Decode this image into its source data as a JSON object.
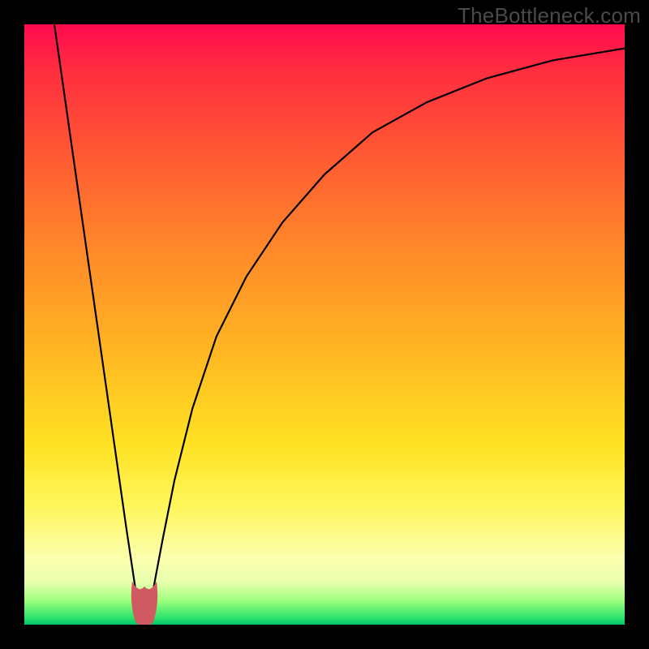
{
  "watermark": {
    "text": "TheBottleneck.com"
  },
  "chart_data": {
    "type": "line",
    "title": "",
    "xlabel": "",
    "ylabel": "",
    "xlim": [
      0,
      100
    ],
    "ylim": [
      0,
      100
    ],
    "grid": false,
    "series": [
      {
        "name": "bottleneck-curve",
        "x": [
          5,
          7,
          9,
          11,
          13,
          15,
          17,
          18.5,
          20,
          21.5,
          23,
          25,
          28,
          32,
          37,
          43,
          50,
          58,
          67,
          77,
          88,
          100
        ],
        "y": [
          100,
          86,
          72,
          58,
          44,
          30,
          16,
          6,
          0,
          6,
          14,
          24,
          36,
          48,
          58,
          67,
          75,
          82,
          87,
          91,
          94,
          96
        ]
      }
    ],
    "highlight": {
      "name": "sweet-spot-blob",
      "x_range": [
        18,
        22
      ],
      "y_range": [
        0,
        7
      ],
      "color": "#cf5a62"
    },
    "background_gradient": {
      "direction": "vertical",
      "stops": [
        {
          "pos": 0.0,
          "color": "#ff0a4f"
        },
        {
          "pos": 0.4,
          "color": "#ff8a29"
        },
        {
          "pos": 0.72,
          "color": "#ffe223"
        },
        {
          "pos": 0.9,
          "color": "#fcffae"
        },
        {
          "pos": 1.0,
          "color": "#00c466"
        }
      ]
    }
  }
}
